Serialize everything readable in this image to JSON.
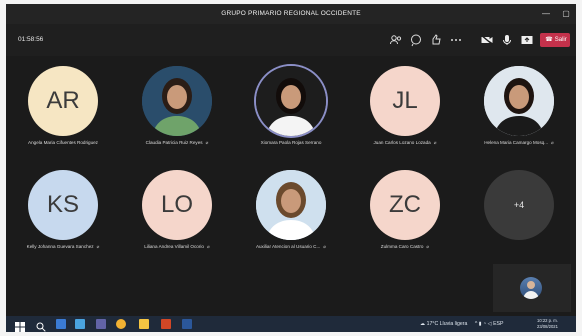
{
  "window": {
    "title": "GRUPO PRIMARIO REGIONAL OCCIDENTE"
  },
  "toolbar": {
    "timer": "01:58:56",
    "leave_label": "Salir"
  },
  "participants": [
    {
      "initials": "AR",
      "name": "Angela Maria Cifuentes Rodriguez",
      "color": "#f6e6c3",
      "has_photo": false,
      "muted": false
    },
    {
      "initials": "",
      "name": "Claudia Patricia Ruiz Reyes",
      "color": "#2a4d6b",
      "has_photo": true,
      "muted": true
    },
    {
      "initials": "",
      "name": "Xiomara Paola Rojas Serrano",
      "color": "#2a2a2a",
      "has_photo": true,
      "muted": false
    },
    {
      "initials": "JL",
      "name": "Juan Carlos Lozano Lozada",
      "color": "#f5d6cb",
      "has_photo": false,
      "muted": true
    },
    {
      "initials": "",
      "name": "Helena Maria Camargo Mosq...",
      "color": "#dfe7ee",
      "has_photo": true,
      "muted": true
    },
    {
      "initials": "KS",
      "name": "Kelly Johanna Guevara Sanchez",
      "color": "#c7d9ee",
      "has_photo": false,
      "muted": true
    },
    {
      "initials": "LO",
      "name": "Liliana Andrea Villamil Ocorio",
      "color": "#f5d6cb",
      "has_photo": false,
      "muted": true
    },
    {
      "initials": "",
      "name": "Auxiliar Atencion al Usuario C...",
      "color": "#cfe0ee",
      "has_photo": true,
      "muted": true
    },
    {
      "initials": "ZC",
      "name": "Zulmma Caro Castro",
      "color": "#f5d6cb",
      "has_photo": false,
      "muted": true
    },
    {
      "initials": "+4",
      "name": "",
      "color": "#3a3a3a",
      "has_photo": false,
      "muted": false
    }
  ],
  "taskbar": {
    "weather": "17°C Lluvia ligera",
    "language": "ESP",
    "time": "10:22 p. m.",
    "date": "23/08/2021"
  },
  "icons": [
    "participants-icon",
    "chat-icon",
    "reactions-icon",
    "more-icon",
    "camera-off-icon",
    "mic-icon",
    "share-icon",
    "phone-icon",
    "start-icon",
    "search-icon"
  ]
}
